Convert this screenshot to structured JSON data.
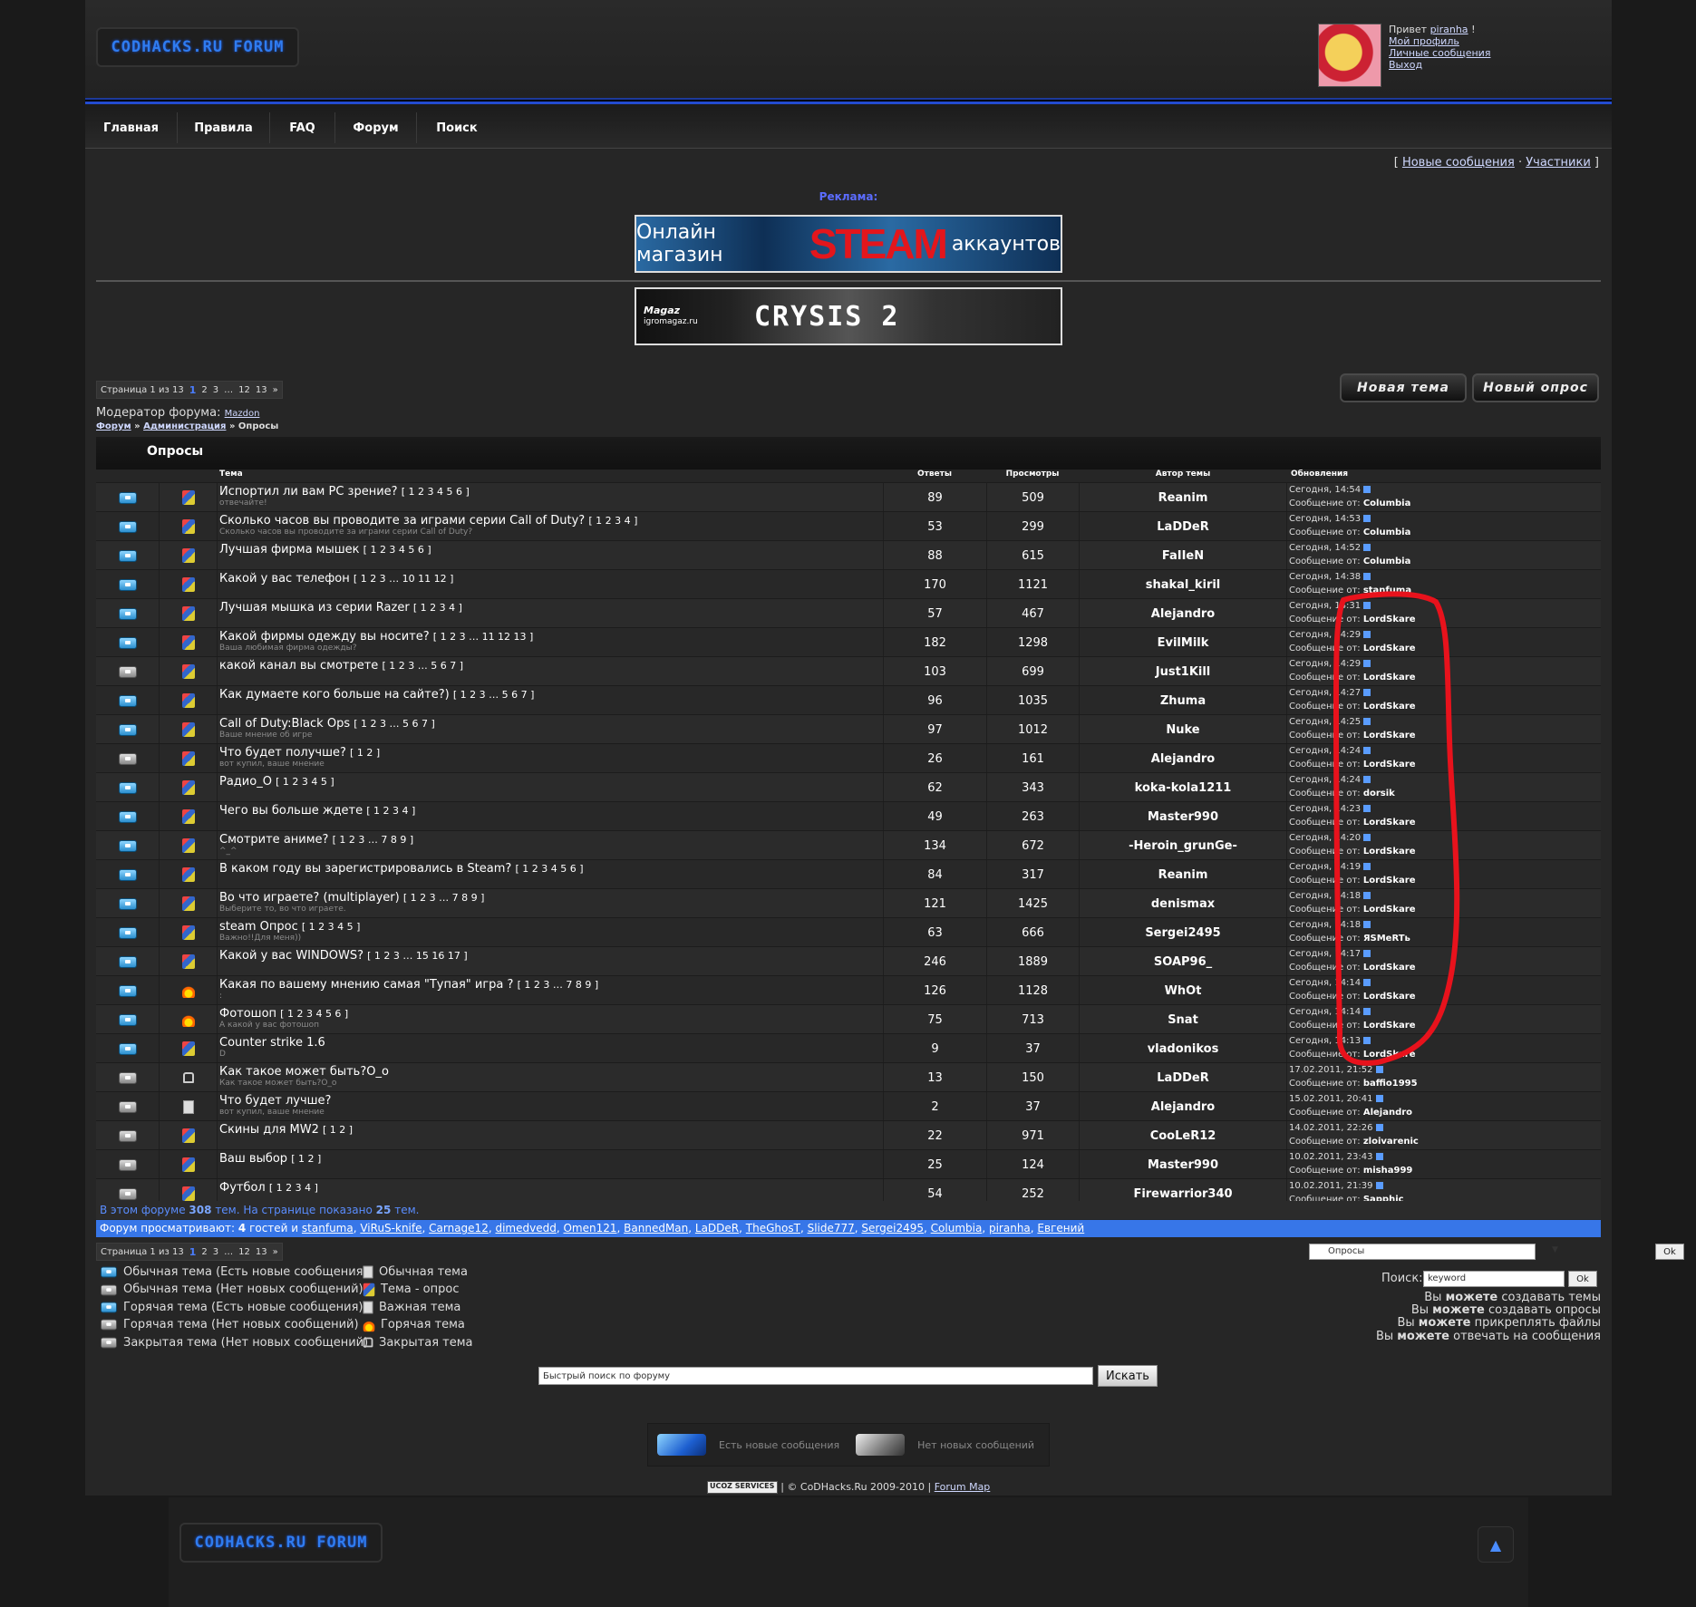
{
  "header": {
    "logo": "CODHACKS.RU FORUM",
    "greeting_prefix": "Привет",
    "username": "piranha",
    "greeting_suffix": "!",
    "links": [
      "Мой профиль",
      "Личные сообщения",
      "Выход"
    ]
  },
  "nav": [
    "Главная",
    "Правила",
    "FAQ",
    "Форум",
    "Поиск"
  ],
  "top_links": {
    "open": "[",
    "new_messages": "Новые сообщения",
    "sep": "·",
    "members": "Участники",
    "close": "]"
  },
  "ads": {
    "label": "Реклама:",
    "banner1_left": "Онлайн магазин",
    "banner1_brand": "STEAM",
    "banner1_right": "аккаунтов",
    "banner2_site": "igromagaz.ru",
    "banner2_logo": "Magaz",
    "banner2_game": "CRYSIS 2"
  },
  "pager": {
    "label": "Страница 1 из 13",
    "current": "1",
    "pages": [
      "2",
      "3",
      "…",
      "12",
      "13",
      "»"
    ]
  },
  "buttons": {
    "new_topic": "Новая тема",
    "new_poll": "Новый опрос"
  },
  "moderator": {
    "label": "Модератор форума:",
    "name": "Mazdon"
  },
  "breadcrumbs": {
    "forum": "Форум",
    "sep": "»",
    "admin": "Администрация",
    "current": "Опросы"
  },
  "forum_title": "Опросы",
  "columns": {
    "topic": "Тема",
    "replies": "Ответы",
    "views": "Просмотры",
    "author": "Автор темы",
    "updates": "Обновления"
  },
  "topics": [
    {
      "icon": "blue",
      "type": "poll",
      "title": "Испортил ли вам PC зрение?",
      "pages": "[ 1 2 3 4 5 6 ]",
      "sub": "отвечайте!",
      "replies": "89",
      "views": "509",
      "author": "Reanim",
      "time": "Сегодня, 14:54",
      "by_label": "Сообщение от:",
      "by": "Columbia"
    },
    {
      "icon": "blue",
      "type": "poll",
      "title": "Сколько часов вы проводите за играми серии Call of Duty?",
      "pages": "[ 1 2 3 4 ]",
      "sub": "Сколько часов вы проводите за играми серии Call of Duty?",
      "replies": "53",
      "views": "299",
      "author": "LaDDeR",
      "time": "Сегодня, 14:53",
      "by_label": "Сообщение от:",
      "by": "Columbia"
    },
    {
      "icon": "blue",
      "type": "poll",
      "title": "Лучшая фирма мышек",
      "pages": "[ 1 2 3 4 5 6 ]",
      "sub": "",
      "replies": "88",
      "views": "615",
      "author": "FaIIeN",
      "time": "Сегодня, 14:52",
      "by_label": "Сообщение от:",
      "by": "Columbia"
    },
    {
      "icon": "blue",
      "type": "poll",
      "title": "Какой у вас телефон",
      "pages": "[ 1 2 3 … 10 11 12 ]",
      "sub": "",
      "replies": "170",
      "views": "1121",
      "author": "shakal_kiril",
      "time": "Сегодня, 14:38",
      "by_label": "Сообщение от:",
      "by": "stanfuma"
    },
    {
      "icon": "blue",
      "type": "poll",
      "title": "Лучшая мышка из серии Razer",
      "pages": "[ 1 2 3 4 ]",
      "sub": "",
      "replies": "57",
      "views": "467",
      "author": "Alejandro",
      "time": "Сегодня, 14:31",
      "by_label": "Сообщение от:",
      "by": "LordSkare"
    },
    {
      "icon": "blue",
      "type": "poll",
      "title": "Какой фирмы одежду вы носите?",
      "pages": "[ 1 2 3 … 11 12 13 ]",
      "sub": "Ваша любимая фирма одежды?",
      "replies": "182",
      "views": "1298",
      "author": "EvilMilk",
      "time": "Сегодня, 14:29",
      "by_label": "Сообщение от:",
      "by": "LordSkare"
    },
    {
      "icon": "gray",
      "type": "poll",
      "title": "какой канал вы смотрете",
      "pages": "[ 1 2 3 … 5 6 7 ]",
      "sub": "",
      "replies": "103",
      "views": "699",
      "author": "Just1Kill",
      "time": "Сегодня, 14:29",
      "by_label": "Сообщение от:",
      "by": "LordSkare"
    },
    {
      "icon": "blue",
      "type": "poll",
      "title": "Как думаете кого больше на сайте?)",
      "pages": "[ 1 2 3 … 5 6 7 ]",
      "sub": "",
      "replies": "96",
      "views": "1035",
      "author": "Zhuma",
      "time": "Сегодня, 14:27",
      "by_label": "Сообщение от:",
      "by": "LordSkare"
    },
    {
      "icon": "blue",
      "type": "poll",
      "title": "Call of Duty:Black Ops",
      "pages": "[ 1 2 3 … 5 6 7 ]",
      "sub": "Ваше мнение об игре",
      "replies": "97",
      "views": "1012",
      "author": "Nuke",
      "time": "Сегодня, 14:25",
      "by_label": "Сообщение от:",
      "by": "LordSkare"
    },
    {
      "icon": "gray",
      "type": "poll",
      "title": "Что будет получше?",
      "pages": "[ 1 2 ]",
      "sub": "вот купил, ваше мнение",
      "replies": "26",
      "views": "161",
      "author": "Alejandro",
      "time": "Сегодня, 14:24",
      "by_label": "Сообщение от:",
      "by": "LordSkare"
    },
    {
      "icon": "blue",
      "type": "poll",
      "title": "Радио_О",
      "pages": "[ 1 2 3 4 5 ]",
      "sub": "",
      "replies": "62",
      "views": "343",
      "author": "koka-kola1211",
      "time": "Сегодня, 14:24",
      "by_label": "Сообщение от:",
      "by": "dorsik"
    },
    {
      "icon": "blue",
      "type": "poll",
      "title": "Чего вы больше ждете",
      "pages": "[ 1 2 3 4 ]",
      "sub": "",
      "replies": "49",
      "views": "263",
      "author": "Master990",
      "time": "Сегодня, 14:23",
      "by_label": "Сообщение от:",
      "by": "LordSkare"
    },
    {
      "icon": "blue",
      "type": "poll",
      "title": "Смотрите аниме?",
      "pages": "[ 1 2 3 … 7 8 9 ]",
      "sub": "^_^",
      "replies": "134",
      "views": "672",
      "author": "-Heroin_grunGe-",
      "time": "Сегодня, 14:20",
      "by_label": "Сообщение от:",
      "by": "LordSkare"
    },
    {
      "icon": "blue",
      "type": "poll",
      "title": "В каком году вы зарегистрировались в Steam?",
      "pages": "[ 1 2 3 4 5 6 ]",
      "sub": "",
      "replies": "84",
      "views": "317",
      "author": "Reanim",
      "time": "Сегодня, 14:19",
      "by_label": "Сообщение от:",
      "by": "LordSkare"
    },
    {
      "icon": "blue",
      "type": "poll",
      "title": "Во что играете? (multiplayer)",
      "pages": "[ 1 2 3 … 7 8 9 ]",
      "sub": "Выберите то, во что играете.",
      "replies": "121",
      "views": "1425",
      "author": "denismax",
      "time": "Сегодня, 14:18",
      "by_label": "Сообщение от:",
      "by": "LordSkare"
    },
    {
      "icon": "blue",
      "type": "poll",
      "title": "steam Опрос",
      "pages": "[ 1 2 3 4 5 ]",
      "sub": "Важно!!Для меня))",
      "replies": "63",
      "views": "666",
      "author": "Sergei2495",
      "time": "Сегодня, 14:18",
      "by_label": "Сообщение от:",
      "by": "ЯSMeRTь"
    },
    {
      "icon": "blue",
      "type": "poll",
      "title": "Какой у вас WINDOWS?",
      "pages": "[ 1 2 3 … 15 16 17 ]",
      "sub": "",
      "replies": "246",
      "views": "1889",
      "author": "SOAP96_",
      "time": "Сегодня, 14:17",
      "by_label": "Сообщение от:",
      "by": "LordSkare"
    },
    {
      "icon": "blue",
      "type": "fire",
      "title": "Какая по вашему мнению самая \"Тупая\" игра ?",
      "pages": "[ 1 2 3 … 7 8 9 ]",
      "sub": ":",
      "replies": "126",
      "views": "1128",
      "author": "WhOt",
      "time": "Сегодня, 14:14",
      "by_label": "Сообщение от:",
      "by": "LordSkare"
    },
    {
      "icon": "blue",
      "type": "fire",
      "title": "Фотошоп",
      "pages": "[ 1 2 3 4 5 6 ]",
      "sub": "А какой у вас фотошоп",
      "replies": "75",
      "views": "713",
      "author": "Snat",
      "time": "Сегодня, 14:14",
      "by_label": "Сообщение от:",
      "by": "LordSkare"
    },
    {
      "icon": "blue",
      "type": "poll",
      "title": "Counter strike 1.6",
      "pages": "",
      "sub": "D",
      "replies": "9",
      "views": "37",
      "author": "vladonikos",
      "time": "Сегодня, 14:13",
      "by_label": "Сообщение от:",
      "by": "LordSkare"
    },
    {
      "icon": "gray",
      "type": "lock",
      "title": "Как такое может быть?O_o",
      "pages": "",
      "sub": "Как такое может быть?O_o",
      "replies": "13",
      "views": "150",
      "author": "LaDDeR",
      "time": "17.02.2011, 21:52",
      "by_label": "Сообщение от:",
      "by": "baffio1995"
    },
    {
      "icon": "gray",
      "type": "doc",
      "title": "Что будет лучше?",
      "pages": "",
      "sub": "вот купил, ваше мнение",
      "replies": "2",
      "views": "37",
      "author": "Alejandro",
      "time": "15.02.2011, 20:41",
      "by_label": "Сообщение от:",
      "by": "Alejandro"
    },
    {
      "icon": "gray",
      "type": "poll",
      "title": "Скины для MW2",
      "pages": "[ 1 2 ]",
      "sub": "",
      "replies": "22",
      "views": "971",
      "author": "CooLeR12",
      "time": "14.02.2011, 22:26",
      "by_label": "Сообщение от:",
      "by": "zloivarenic"
    },
    {
      "icon": "gray",
      "type": "poll",
      "title": "Ваш выбор",
      "pages": "[ 1 2 ]",
      "sub": "",
      "replies": "25",
      "views": "124",
      "author": "Master990",
      "time": "10.02.2011, 23:43",
      "by_label": "Сообщение от:",
      "by": "misha999"
    },
    {
      "icon": "gray",
      "type": "poll",
      "title": "Футбол",
      "pages": "[ 1 2 3 4 ]",
      "sub": "",
      "replies": "54",
      "views": "252",
      "author": "Firewarrior340",
      "time": "10.02.2011, 21:39",
      "by_label": "Сообщение от:",
      "by": "Sapphic"
    }
  ],
  "stats": {
    "prefix": "В этом форуме",
    "topics": "308",
    "mid": "тем. На странице показано",
    "shown": "25",
    "suffix": "тем."
  },
  "online": {
    "prefix": "Форум просматривают:",
    "guests": "4",
    "guests_suffix": "гостей и",
    "users": [
      "stanfuma",
      "ViRuS-knife",
      "Carnage12",
      "dimedvedd",
      "Omen121",
      "BannedMan",
      "LaDDeR",
      "TheGhosT",
      "Slide777",
      "Sergei2495",
      "Columbia",
      "piranha",
      "Евгений"
    ]
  },
  "legend_left": [
    "Обычная тема (Есть новые сообщения)",
    "Обычная тема (Нет новых сообщений)",
    "Горячая тема (Есть новые сообщения)",
    "Горячая тема (Нет новых сообщений)",
    "Закрытая тема (Нет новых сообщений)"
  ],
  "legend_right": [
    "Обычная тема",
    "Тема - опрос",
    "Важная тема",
    "Горячая тема",
    "Закрытая тема"
  ],
  "jump": {
    "selected": "Опросы",
    "ok": "Ok"
  },
  "search": {
    "label": "Поиск:",
    "value": "keyword",
    "ok": "Ok"
  },
  "permissions": [
    {
      "pre": "Вы",
      "bold": "можете",
      "post": "создавать темы"
    },
    {
      "pre": "Вы",
      "bold": "можете",
      "post": "создавать опросы"
    },
    {
      "pre": "Вы",
      "bold": "можете",
      "post": "прикреплять файлы"
    },
    {
      "pre": "Вы",
      "bold": "можете",
      "post": "отвечать на сообщения"
    }
  ],
  "quick_search": {
    "placeholder": "Быстрый поиск по форуму",
    "button": "Искать"
  },
  "newbox": {
    "has_new": "Есть новые сообщения",
    "no_new": "Нет новых сообщений"
  },
  "copyright": {
    "ucoz": "UCOZ SERVICES",
    "text": "| © CoDHacks.Ru 2009-2010 |",
    "map": "Forum Map"
  },
  "footer": {
    "logo": "CODHACKS.RU FORUM",
    "up": "▲"
  },
  "colors": {
    "accent": "#2f7cf0",
    "online_bar": "#3776e8",
    "annotation": "#e8121c"
  }
}
